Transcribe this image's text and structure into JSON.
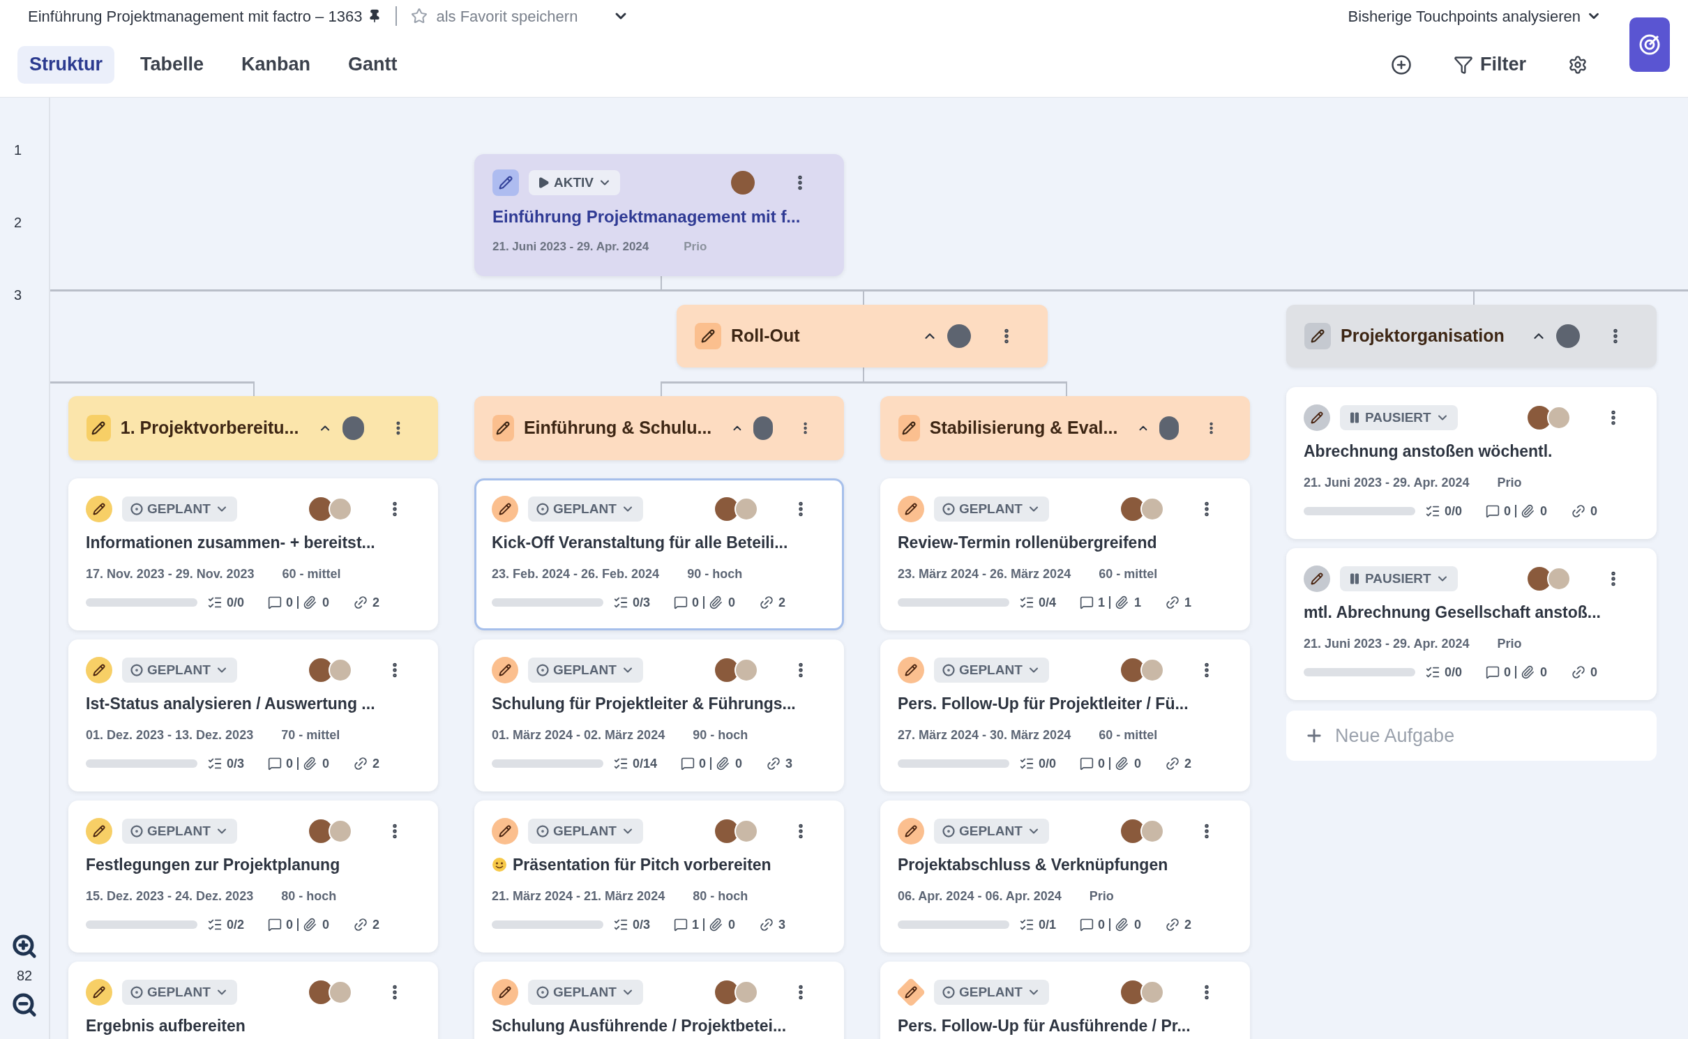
{
  "header": {
    "title": "Einführung Projektmanagement mit factro – 1363",
    "favorite": "als Favorit speichern",
    "touchpoints": "Bisherige Touchpoints analysieren"
  },
  "tabs": [
    {
      "label": "Struktur",
      "selected": true
    },
    {
      "label": "Tabelle",
      "selected": false
    },
    {
      "label": "Kanban",
      "selected": false
    },
    {
      "label": "Gantt",
      "selected": false
    }
  ],
  "toolbar": {
    "filter": "Filter"
  },
  "row_numbers": [
    "1",
    "2",
    "3"
  ],
  "zoom": "82",
  "root": {
    "status": {
      "label": "AKTIV",
      "kind": "active"
    },
    "title": "Einführung Projektmanagement mit f...",
    "dates": "21. Juni 2023 - 29. Apr. 2024",
    "prio": "Prio"
  },
  "rollout": {
    "title": "Roll-Out",
    "color": "#fbbf8e",
    "expanded": true
  },
  "groups": [
    {
      "title": "1. Projektvorbereitu...",
      "color": "#f7cf66",
      "expanded": true,
      "tasks": [
        {
          "kind": "task",
          "status": {
            "label": "GEPLANT",
            "kind": "planned"
          },
          "emoji": false,
          "selected": false,
          "title": "Informationen zusammen- + bereitst...",
          "dates": "17. Nov. 2023 - 29. Nov. 2023",
          "prio": "60 - mittel",
          "level": 0,
          "checklist": "0/0",
          "comments": "0",
          "attachments": "0",
          "links": "2"
        },
        {
          "kind": "task",
          "status": {
            "label": "GEPLANT",
            "kind": "planned"
          },
          "emoji": false,
          "selected": false,
          "title": "Ist-Status analysieren / Auswertung ...",
          "dates": "01. Dez. 2023 - 13. Dez. 2023",
          "prio": "70 - mittel",
          "level": 0,
          "checklist": "0/3",
          "comments": "0",
          "attachments": "0",
          "links": "2"
        },
        {
          "kind": "task",
          "status": {
            "label": "GEPLANT",
            "kind": "planned"
          },
          "emoji": false,
          "selected": false,
          "title": "Festlegungen zur Projektplanung",
          "dates": "15. Dez. 2023 - 24. Dez. 2023",
          "prio": "80 - hoch",
          "level": 0,
          "checklist": "0/2",
          "comments": "0",
          "attachments": "0",
          "links": "2"
        },
        {
          "kind": "task",
          "status": {
            "label": "GEPLANT",
            "kind": "planned"
          },
          "emoji": false,
          "selected": false,
          "title": "Ergebnis aufbereiten"
        }
      ]
    },
    {
      "title": "Einführung & Schulu...",
      "color": "#fbbf8e",
      "expanded": true,
      "tasks": [
        {
          "kind": "task",
          "status": {
            "label": "GEPLANT",
            "kind": "planned"
          },
          "emoji": false,
          "selected": true,
          "title": "Kick-Off Veranstaltung für alle Beteili...",
          "dates": "23. Feb. 2024 - 26. Feb. 2024",
          "prio": "90 - hoch",
          "level": 0,
          "checklist": "0/3",
          "comments": "0",
          "attachments": "0",
          "links": "2"
        },
        {
          "kind": "task",
          "status": {
            "label": "GEPLANT",
            "kind": "planned"
          },
          "emoji": false,
          "selected": false,
          "title": "Schulung für Projektleiter & Führungs...",
          "dates": "01. März 2024 - 02. März 2024",
          "prio": "90 - hoch",
          "level": 0,
          "checklist": "0/14",
          "comments": "0",
          "attachments": "0",
          "links": "3"
        },
        {
          "kind": "task",
          "status": {
            "label": "GEPLANT",
            "kind": "planned"
          },
          "emoji": true,
          "selected": false,
          "title": "Präsentation für Pitch vorbereiten",
          "dates": "21. März 2024 - 21. März 2024",
          "prio": "80 - hoch",
          "level": 0,
          "checklist": "0/3",
          "comments": "1",
          "attachments": "0",
          "links": "3"
        },
        {
          "kind": "task",
          "status": {
            "label": "GEPLANT",
            "kind": "planned"
          },
          "emoji": false,
          "selected": false,
          "title": "Schulung Ausführende / Projektbetei..."
        }
      ]
    },
    {
      "title": "Stabilisierung & Eval...",
      "color": "#fbbf8f",
      "expanded": true,
      "tasks": [
        {
          "kind": "task",
          "status": {
            "label": "GEPLANT",
            "kind": "planned"
          },
          "emoji": false,
          "selected": false,
          "title": "Review-Termin rollenübergreifend",
          "dates": "23. März 2024 - 26. März 2024",
          "prio": "60 - mittel",
          "level": 0,
          "checklist": "0/4",
          "comments": "1",
          "attachments": "1",
          "links": "1"
        },
        {
          "kind": "task",
          "status": {
            "label": "GEPLANT",
            "kind": "planned"
          },
          "emoji": false,
          "selected": false,
          "title": "Pers. Follow-Up für Projektleiter / Fü...",
          "dates": "27. März 2024 - 30. März 2024",
          "prio": "60 - mittel",
          "level": 0,
          "checklist": "0/0",
          "comments": "0",
          "attachments": "0",
          "links": "2"
        },
        {
          "kind": "task",
          "status": {
            "label": "GEPLANT",
            "kind": "planned"
          },
          "emoji": false,
          "selected": false,
          "title": "Projektabschluss & Verknüpfungen",
          "dates": "06. Apr. 2024 - 06. Apr. 2024",
          "prio": "Prio",
          "level": 0,
          "checklist": "0/1",
          "comments": "0",
          "attachments": "0",
          "links": "2"
        },
        {
          "kind": "milestone",
          "status": {
            "label": "GEPLANT",
            "kind": "planned"
          },
          "emoji": false,
          "selected": false,
          "title": "Pers. Follow-Up für Ausführende / Pr..."
        }
      ]
    },
    {
      "title": "Projektorganisation",
      "color": "#c5c9d0",
      "expanded": true,
      "new_task": "Neue Aufgabe",
      "tasks": [
        {
          "kind": "task",
          "status": {
            "label": "PAUSIERT",
            "kind": "paused"
          },
          "emoji": false,
          "selected": false,
          "title": "Abrechnung anstoßen wöchentl.",
          "dates": "21. Juni 2023 - 29. Apr. 2024",
          "prio": "Prio",
          "level": 0,
          "checklist": "0/0",
          "comments": "0",
          "attachments": "0",
          "links": "0"
        },
        {
          "kind": "task",
          "status": {
            "label": "PAUSIERT",
            "kind": "paused"
          },
          "emoji": false,
          "selected": false,
          "title": "mtl. Abrechnung Gesellschaft anstoß...",
          "dates": "21. Juni 2023 - 29. Apr. 2024",
          "prio": "Prio",
          "level": 0,
          "checklist": "0/0",
          "comments": "0",
          "attachments": "0",
          "links": "0"
        }
      ]
    }
  ]
}
